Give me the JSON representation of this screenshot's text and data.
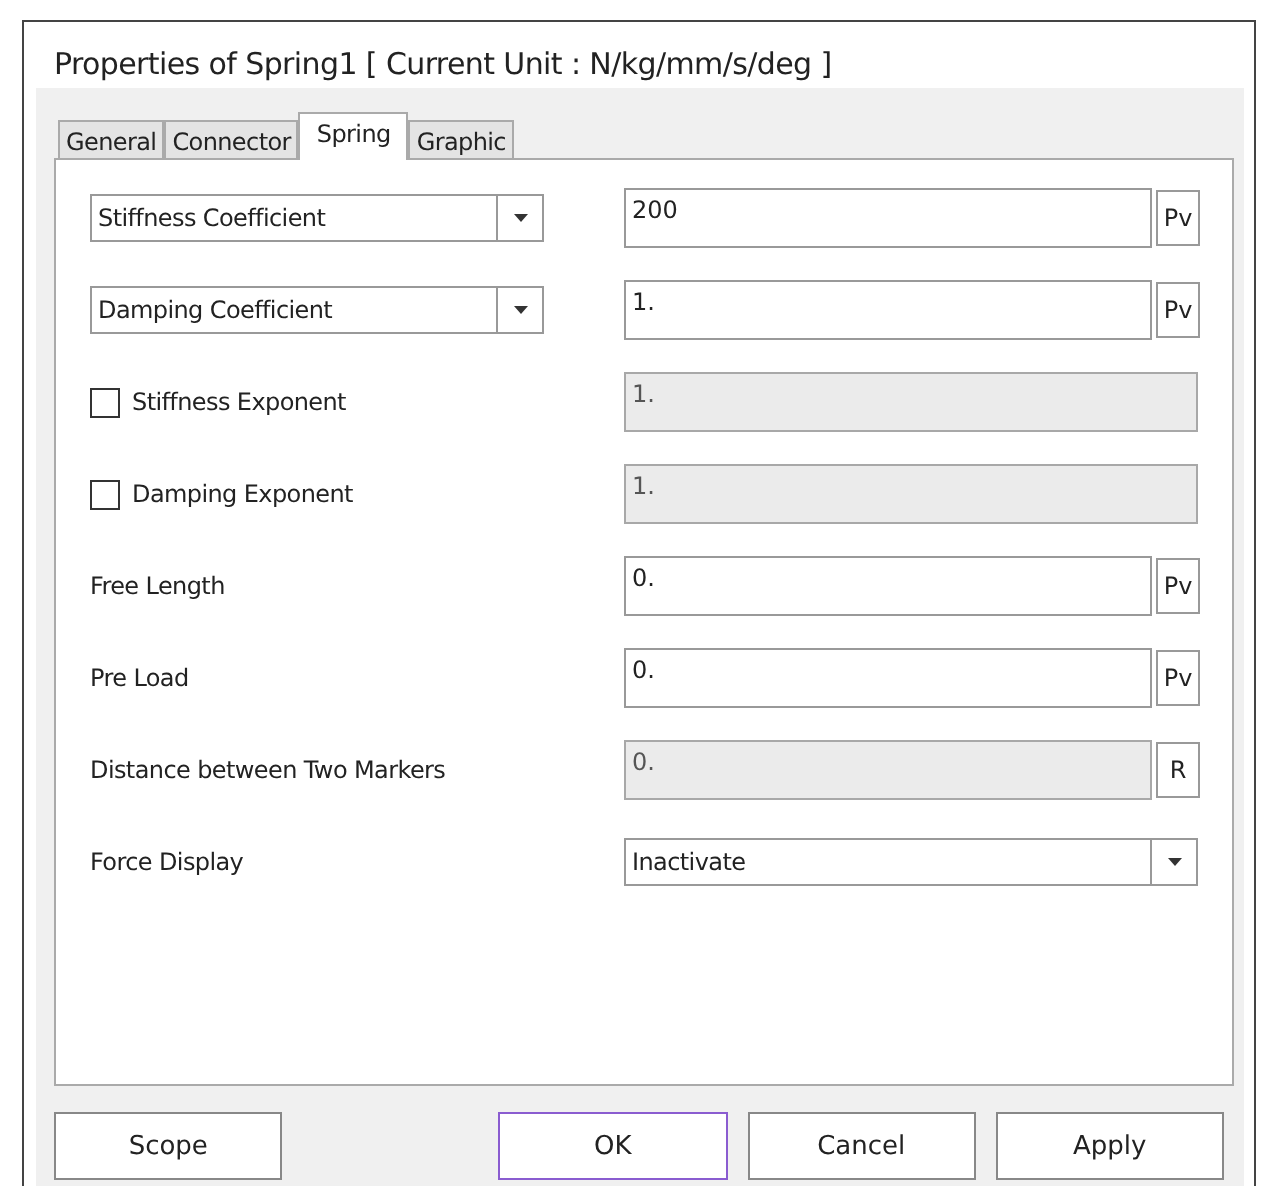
{
  "window": {
    "title": "Properties of Spring1 [ Current Unit : N/kg/mm/s/deg ]"
  },
  "tabs": [
    {
      "label": "General",
      "selected": false
    },
    {
      "label": "Connector",
      "selected": false
    },
    {
      "label": "Spring",
      "selected": true
    },
    {
      "label": "Graphic",
      "selected": false
    }
  ],
  "rows": [
    {
      "kind": "dropdown",
      "label": "Stiffness Coefficient",
      "field": {
        "kind": "text",
        "value": "200",
        "disabled": false
      },
      "side_button": "Pv"
    },
    {
      "kind": "dropdown",
      "label": "Damping Coefficient",
      "field": {
        "kind": "text",
        "value": "1.",
        "disabled": false
      },
      "side_button": "Pv"
    },
    {
      "kind": "checkbox",
      "label": "Stiffness Exponent",
      "checked": false,
      "field": {
        "kind": "text",
        "value": "1.",
        "disabled": true
      }
    },
    {
      "kind": "checkbox",
      "label": "Damping Exponent",
      "checked": false,
      "field": {
        "kind": "text",
        "value": "1.",
        "disabled": true
      }
    },
    {
      "kind": "label",
      "label": "Free Length",
      "field": {
        "kind": "text",
        "value": "0.",
        "disabled": false
      },
      "side_button": "Pv"
    },
    {
      "kind": "label",
      "label": "Pre Load",
      "field": {
        "kind": "text",
        "value": "0.",
        "disabled": false
      },
      "side_button": "Pv"
    },
    {
      "kind": "label",
      "label": "Distance between Two Markers",
      "field": {
        "kind": "text",
        "value": "0.",
        "disabled": true
      },
      "side_button": "R"
    },
    {
      "kind": "label",
      "label": "Force Display",
      "field": {
        "kind": "select",
        "value": "Inactivate",
        "disabled": false
      }
    }
  ],
  "buttons": [
    {
      "label": "Scope",
      "focused": false
    },
    {
      "label": "OK",
      "focused": true
    },
    {
      "label": "Cancel",
      "focused": false
    },
    {
      "label": "Apply",
      "focused": false
    }
  ]
}
